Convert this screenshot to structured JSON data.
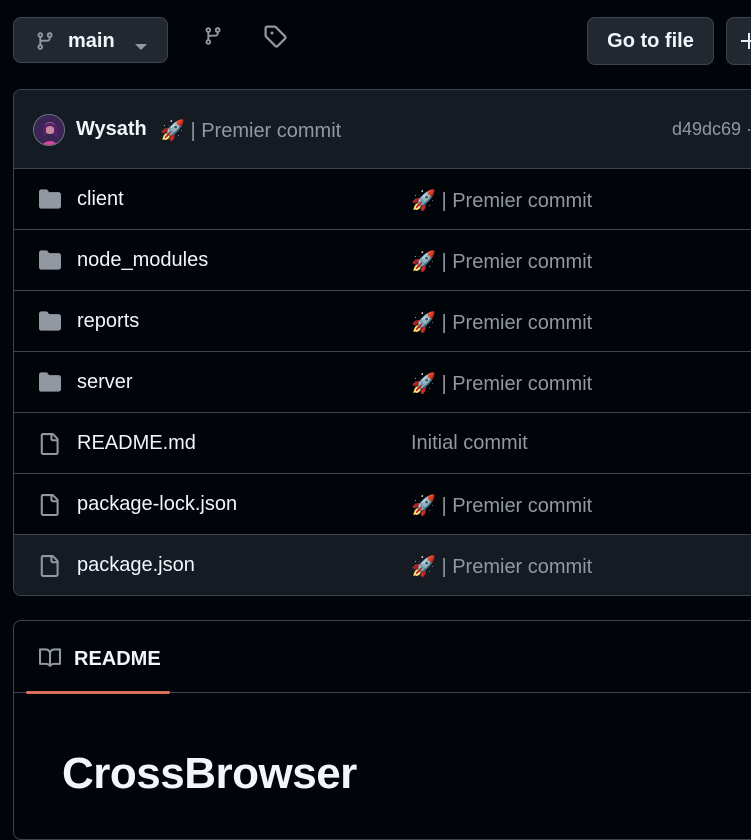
{
  "toolbar": {
    "branch_name": "main",
    "go_to_file_label": "Go to file"
  },
  "latest_commit": {
    "author": "Wysath",
    "message": "🚀 | Premier commit",
    "hash": "d49dc69 ·"
  },
  "files": [
    {
      "type": "folder",
      "name": "client",
      "message": "🚀 | Premier commit"
    },
    {
      "type": "folder",
      "name": "node_modules",
      "message": "🚀 | Premier commit"
    },
    {
      "type": "folder",
      "name": "reports",
      "message": "🚀 | Premier commit"
    },
    {
      "type": "folder",
      "name": "server",
      "message": "🚀 | Premier commit"
    },
    {
      "type": "file",
      "name": "README.md",
      "message": "Initial commit"
    },
    {
      "type": "file",
      "name": "package-lock.json",
      "message": "🚀 | Premier commit"
    },
    {
      "type": "file",
      "name": "package.json",
      "message": "🚀 | Premier commit"
    }
  ],
  "readme": {
    "tab_label": "README",
    "title": "CrossBrowser"
  },
  "colors": {
    "background": "#010409",
    "border": "#3d444d",
    "header_bg": "#151b23",
    "muted_text": "#9198a1",
    "accent_underline": "#f78166",
    "folder_icon": "#9198a1"
  },
  "icons": {
    "branch": "git-branch-icon",
    "tag": "tag-icon",
    "folder": "folder-icon",
    "file": "file-icon",
    "book": "book-icon",
    "plus": "plus-icon",
    "caret": "triangle-down-icon"
  }
}
